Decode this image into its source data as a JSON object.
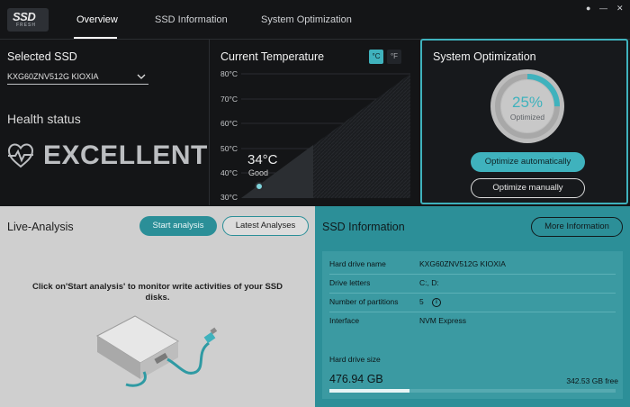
{
  "app": {
    "logo_main": "SSD",
    "logo_sub": "FRESH"
  },
  "nav": {
    "tabs": [
      "Overview",
      "SSD Information",
      "System Optimization"
    ],
    "active": "Overview"
  },
  "ssd_panel": {
    "heading": "Selected SSD",
    "selected_ssd": "KXG60ZNV512G KIOXIA",
    "health_heading": "Health status",
    "health_value": "EXCELLENT"
  },
  "temperature": {
    "heading": "Current Temperature",
    "unit_c": "°C",
    "unit_f": "°F",
    "active_unit": "°C",
    "axis_labels": [
      "80°C",
      "70°C",
      "60°C",
      "50°C",
      "40°C",
      "30°C"
    ],
    "reading": "34°C",
    "status": "Good",
    "value_celsius": 34
  },
  "optimization": {
    "heading": "System Optimization",
    "percent": 25,
    "percent_label": "25%",
    "sub_label": "Optimized",
    "btn_auto": "Optimize automatically",
    "btn_manual": "Optimize manually",
    "accent": "#3fb2bd"
  },
  "live_analysis": {
    "heading": "Live-Analysis",
    "btn_start": "Start analysis",
    "btn_latest": "Latest Analyses",
    "description": "Click on'Start analysis' to monitor write activities of your SSD disks."
  },
  "ssd_info": {
    "heading": "SSD Information",
    "btn_more": "More Information",
    "rows": [
      {
        "label": "Hard drive name",
        "value": "KXG60ZNV512G KIOXIA"
      },
      {
        "label": "Drive letters",
        "value": "C:, D:"
      },
      {
        "label": "Number of partitions",
        "value": "5"
      },
      {
        "label": "Interface",
        "value": "NVM Express"
      }
    ],
    "info_icon": "i",
    "size_label": "Hard drive size",
    "size_value": "476.94 GB",
    "free_value": "342.53 GB free",
    "used_fraction": 0.28
  },
  "colors": {
    "accent": "#3fb2bd",
    "info_bg": "#2c8f98",
    "live_bg": "#cfcfcf"
  },
  "icons": [
    "heartbeat-icon",
    "chevron-down-icon",
    "info-icon",
    "minimize-icon",
    "close-icon"
  ]
}
